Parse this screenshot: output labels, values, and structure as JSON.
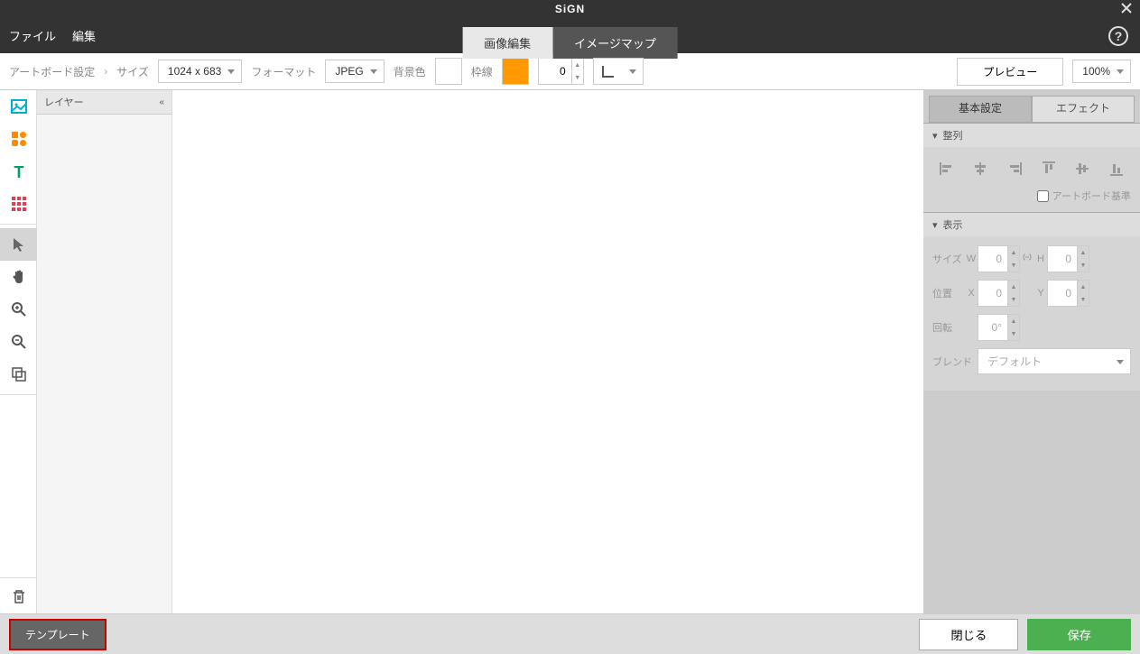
{
  "title": "SiGN",
  "menu": {
    "file": "ファイル",
    "edit": "編集"
  },
  "tabs": {
    "image_edit": "画像編集",
    "image_map": "イメージマップ"
  },
  "toolbar": {
    "artboard_label": "アートボード設定",
    "size_label": "サイズ",
    "size_value": "1024 x 683",
    "format_label": "フォーマット",
    "format_value": "JPEG",
    "bgcolor_label": "背景色",
    "bgcolor_value": "#ffffff",
    "border_label": "枠線",
    "border_color": "#ff9900",
    "border_width": "0",
    "preview": "プレビュー",
    "zoom": "100%"
  },
  "layer_panel": "レイヤー",
  "props": {
    "tab_basic": "基本設定",
    "tab_effect": "エフェクト",
    "section_align": "整列",
    "artboard_basis": "アートボード基準",
    "section_display": "表示",
    "size_label": "サイズ",
    "w_label": "W",
    "h_label": "H",
    "w_value": "0",
    "h_value": "0",
    "position_label": "位置",
    "x_label": "X",
    "y_label": "Y",
    "x_value": "0",
    "y_value": "0",
    "rotation_label": "回転",
    "rotation_value": "0°",
    "blend_label": "ブレンド",
    "blend_value": "デフォルト"
  },
  "bottom": {
    "template": "テンプレート",
    "close": "閉じる",
    "save": "保存"
  }
}
